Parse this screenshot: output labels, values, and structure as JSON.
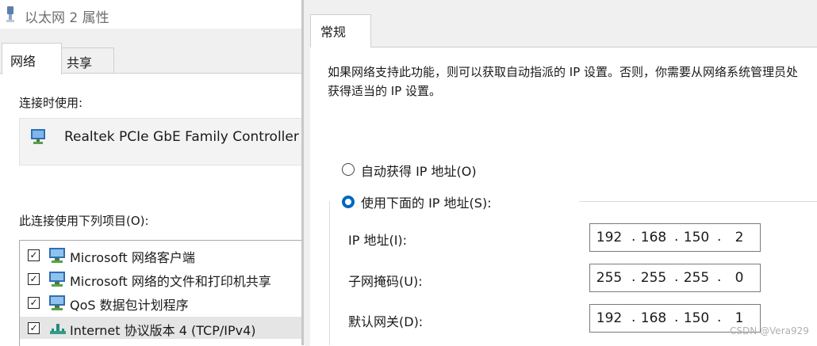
{
  "left_window": {
    "title": "以太网 2 属性",
    "tabs": [
      {
        "label": "网络",
        "active": true
      },
      {
        "label": "共享",
        "active": false
      }
    ],
    "connect_using_label": "连接时使用:",
    "adapter_name": "Realtek PCIe GbE Family Controller",
    "items_label": "此连接使用下列项目(O):",
    "items": [
      {
        "label": "Microsoft 网络客户端",
        "checked": true,
        "icon": "network-client-icon"
      },
      {
        "label": "Microsoft 网络的文件和打印机共享",
        "checked": true,
        "icon": "file-printer-sharing-icon"
      },
      {
        "label": "QoS 数据包计划程序",
        "checked": true,
        "icon": "qos-icon"
      },
      {
        "label": "Internet 协议版本 4 (TCP/IPv4)",
        "checked": true,
        "selected": true,
        "icon": "protocol-icon"
      }
    ]
  },
  "right_window": {
    "tab_label": "常规",
    "description": "如果网络支持此功能，则可以获取自动指派的 IP 设置。否则，你需要从网络系统管理员处获得适当的 IP 设置。",
    "radio_auto_label": "自动获得 IP 地址(O)",
    "radio_manual_label": "使用下面的 IP 地址(S):",
    "selected_radio": "manual",
    "fields": [
      {
        "label": "IP 地址(I):",
        "octets": [
          "192",
          "168",
          "150",
          "2"
        ]
      },
      {
        "label": "子网掩码(U):",
        "octets": [
          "255",
          "255",
          "255",
          "0"
        ]
      },
      {
        "label": "默认网关(D):",
        "octets": [
          "192",
          "168",
          "150",
          "1"
        ]
      }
    ]
  },
  "watermark": "CSDN @Vera929",
  "colors": {
    "accent": "#0067c0",
    "panel": "#ffffff",
    "chrome": "#f0f0f0"
  }
}
